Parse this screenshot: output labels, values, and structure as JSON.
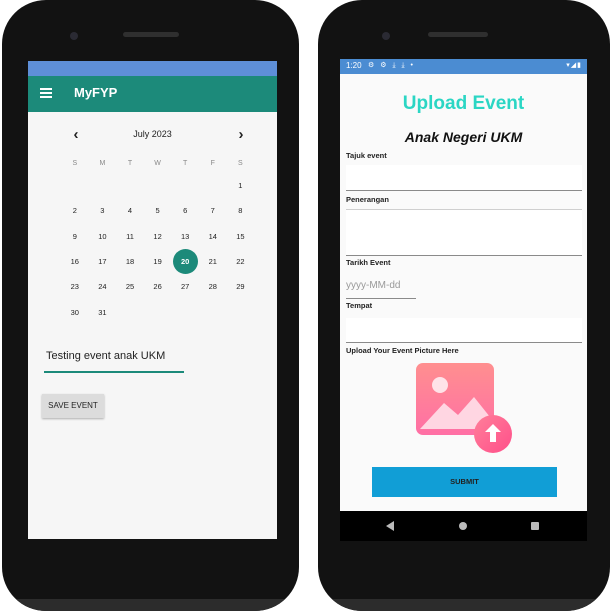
{
  "left_app": {
    "app_title": "MyFYP",
    "calendar": {
      "month_label": "July 2023",
      "prev_icon": "chevron-left-icon",
      "next_icon": "chevron-right-icon",
      "weekday_headers": [
        "S",
        "M",
        "T",
        "W",
        "T",
        "F",
        "S"
      ],
      "weeks": [
        [
          "",
          "",
          "",
          "",
          "",
          "",
          "1"
        ],
        [
          "2",
          "3",
          "4",
          "5",
          "6",
          "7",
          "8"
        ],
        [
          "9",
          "10",
          "11",
          "12",
          "13",
          "14",
          "15"
        ],
        [
          "16",
          "17",
          "18",
          "19",
          "20",
          "21",
          "22"
        ],
        [
          "23",
          "24",
          "25",
          "26",
          "27",
          "28",
          "29"
        ],
        [
          "30",
          "31",
          "",
          "",
          "",
          "",
          ""
        ]
      ],
      "selected_day": "20"
    },
    "event_input_value": "Testing event anak UKM",
    "save_button_label": "SAVE EVENT",
    "colors": {
      "accent": "#1c8a7a",
      "status_bar": "#5e8fd8"
    }
  },
  "right_app": {
    "status": {
      "time": "1:20"
    },
    "title": "Upload Event",
    "org_name": "Anak Negeri UKM",
    "fields": {
      "tajuk_label": "Tajuk event",
      "penerangan_label": "Penerangan",
      "tarikh_label": "Tarikh Event",
      "tarikh_placeholder": "yyyy-MM-dd",
      "tempat_label": "Tempat",
      "upload_label": "Upload Your Event Picture Here"
    },
    "upload_icon": "image-upload-icon",
    "submit_label": "SUBMIT",
    "colors": {
      "title": "#2bd6c4",
      "submit": "#119ed6",
      "status_bar": "#4b8cd2"
    }
  }
}
